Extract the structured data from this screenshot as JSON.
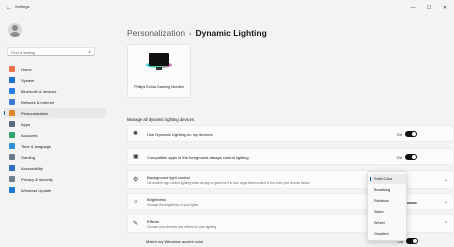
{
  "window": {
    "app_title": "Settings",
    "minimize_glyph": "—",
    "maximize_glyph": "☐",
    "close_glyph": "✕"
  },
  "sidebar": {
    "search_placeholder": "Find a setting",
    "items": [
      {
        "label": "Home",
        "icon": "home-icon",
        "color": "#e8734a"
      },
      {
        "label": "System",
        "icon": "system-icon",
        "color": "#1f6fd1"
      },
      {
        "label": "Bluetooth & devices",
        "icon": "bluetooth-icon",
        "color": "#2a7de1"
      },
      {
        "label": "Network & internet",
        "icon": "network-icon",
        "color": "#3a7bd5"
      },
      {
        "label": "Personalization",
        "icon": "personalization-icon",
        "color": "#e0862a",
        "active": true
      },
      {
        "label": "Apps",
        "icon": "apps-icon",
        "color": "#5a6b7d"
      },
      {
        "label": "Accounts",
        "icon": "accounts-icon",
        "color": "#2fa36b"
      },
      {
        "label": "Time & language",
        "icon": "time-language-icon",
        "color": "#2a8fd6"
      },
      {
        "label": "Gaming",
        "icon": "gaming-icon",
        "color": "#6b7b8c"
      },
      {
        "label": "Accessibility",
        "icon": "accessibility-icon",
        "color": "#2d6fc4"
      },
      {
        "label": "Privacy & security",
        "icon": "privacy-icon",
        "color": "#707c88"
      },
      {
        "label": "Windows Update",
        "icon": "windows-update-icon",
        "color": "#1f78d1"
      }
    ]
  },
  "header": {
    "parent": "Personalization",
    "separator": "›",
    "current": "Dynamic Lighting"
  },
  "device": {
    "name": "Philips Evnia Gaming Monitor"
  },
  "section": {
    "title": "Manage all dynamic lighting devices"
  },
  "settings": {
    "use_dynamic": {
      "title": "Use Dynamic Lighting on my devices",
      "state": "On",
      "icon": "lightbulb-icon"
    },
    "compatible_apps": {
      "title": "Compatible apps in the foreground always control lighting",
      "state": "On",
      "icon": "apps-control-icon"
    },
    "background_control": {
      "title": "Background light control",
      "description": "Let another app control lighting when an app or game isn't in use. Apps listed control in the order you choose below.",
      "icon": "background-light-icon"
    },
    "brightness": {
      "title": "Brightness",
      "description": "Change the brightness of your lights",
      "icon": "brightness-icon",
      "level": 0.72
    },
    "effects": {
      "title": "Effects",
      "description": "Choose color themes and effects for your lighting",
      "icon": "effects-icon"
    },
    "accent": {
      "title": "Match my Windows accent color",
      "state": "On"
    }
  },
  "dropdown": {
    "options": [
      "Solid Color",
      "Breathing",
      "Rainbow",
      "Wave",
      "Wheel",
      "Gradient"
    ],
    "selected": "Solid Color"
  }
}
